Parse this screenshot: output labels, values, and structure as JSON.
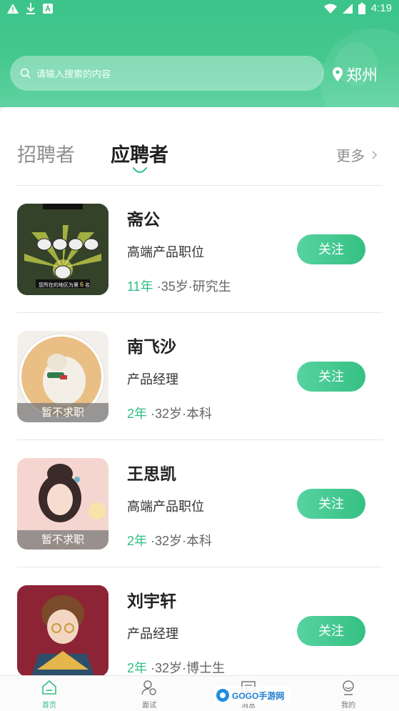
{
  "status_bar": {
    "time": "4:19",
    "icons_left": [
      "warning-icon",
      "download-icon",
      "a-icon"
    ],
    "icons_right": [
      "wifi-icon",
      "signal-icon",
      "battery-icon"
    ]
  },
  "search": {
    "placeholder": "请输入搜索的内容"
  },
  "location": {
    "city": "郑州"
  },
  "tabs": {
    "items": [
      "招聘者",
      "应聘者"
    ],
    "active": "应聘者",
    "more": "更多"
  },
  "candidates": [
    {
      "name": "斋公",
      "position": "高端产品职位",
      "years": "11年",
      "details": "·35岁·研究生",
      "status": "",
      "follow": "关注",
      "avatar_text": [
        "您所在的地区为第",
        "6",
        "名"
      ]
    },
    {
      "name": "南飞沙",
      "position": "产品经理",
      "years": "2年",
      "details": "·32岁·本科",
      "status": "暂不求职",
      "follow": "关注"
    },
    {
      "name": "王思凯",
      "position": "高端产品职位",
      "years": "2年",
      "details": "·32岁·本科",
      "status": "暂不求职",
      "follow": "关注"
    },
    {
      "name": "刘宇轩",
      "position": "产品经理",
      "years": "2年",
      "details": "·32岁·博士生",
      "status": "",
      "follow": "关注"
    }
  ],
  "bottom_nav": [
    {
      "label": "首页",
      "icon": "home-icon",
      "active": true
    },
    {
      "label": "面试",
      "icon": "interview-icon",
      "active": false
    },
    {
      "label": "消息",
      "icon": "message-icon",
      "active": false
    },
    {
      "label": "我的",
      "icon": "profile-icon",
      "active": false
    }
  ],
  "watermark": "GOGO手游网",
  "colors": {
    "primary": "#3cc48a",
    "accent_text": "#2fbf84"
  }
}
